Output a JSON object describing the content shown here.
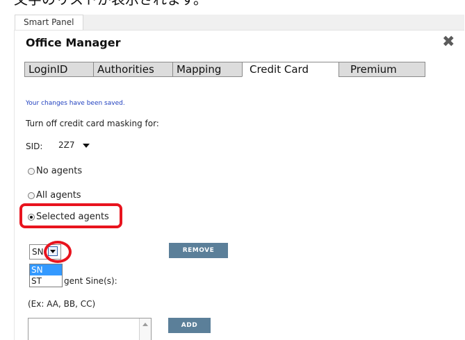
{
  "caption": "ー文字のリストが表示されます。",
  "smart_panel_tab": "Smart Panel",
  "title": "Office Manager",
  "close_symbol": "✖",
  "tabs": [
    {
      "label": "LoginID",
      "active": false
    },
    {
      "label": "Authorities",
      "active": false
    },
    {
      "label": "Mapping",
      "active": false
    },
    {
      "label": "Credit Card",
      "active": true
    },
    {
      "label": "Premium",
      "active": false
    }
  ],
  "saved_message": "Your changes have been saved.",
  "masking_label": "Turn off credit card masking for:",
  "sid": {
    "label": "SID:",
    "value": "2Z7"
  },
  "radios": [
    {
      "label": "No agents",
      "checked": false
    },
    {
      "label": "All agents",
      "checked": false
    },
    {
      "label": "Selected agents",
      "checked": true
    }
  ],
  "agent_select": {
    "value": "SN"
  },
  "agent_options": [
    "SN",
    "ST"
  ],
  "remove_button": "REMOVE",
  "agent_sine_label": "gent Sine(s):",
  "example_text": "(Ex: AA, BB, CC)",
  "add_button": "ADD",
  "colors": {
    "highlight": "#e8141e",
    "button": "#5b7f99",
    "saved_text": "#1f3fbf",
    "selected_option": "#3399ff"
  }
}
